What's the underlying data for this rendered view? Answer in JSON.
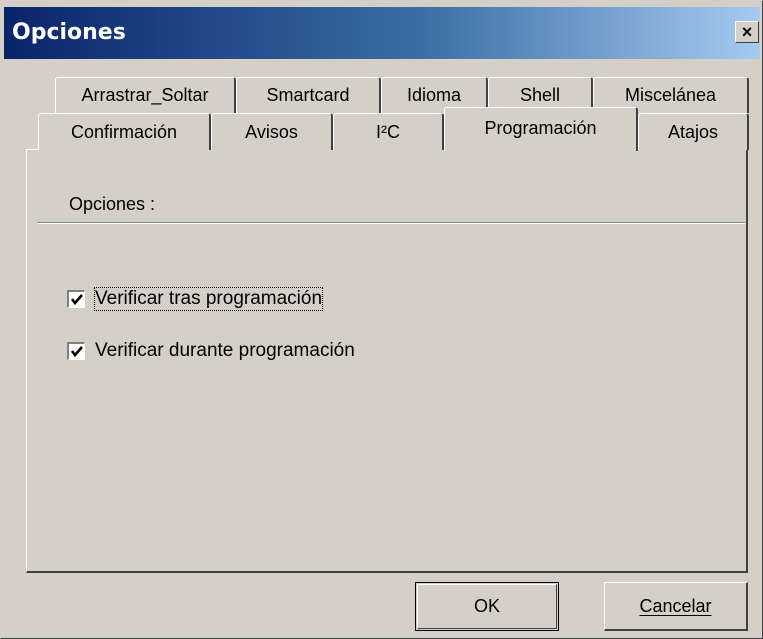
{
  "window": {
    "title": "Opciones",
    "close_label": "×"
  },
  "tabs_row1": [
    {
      "label": "Arrastrar_Soltar"
    },
    {
      "label": "Smartcard"
    },
    {
      "label": "Idioma"
    },
    {
      "label": "Shell"
    },
    {
      "label": "Miscelánea"
    }
  ],
  "tabs_row2": [
    {
      "label": "Confirmación"
    },
    {
      "label": "Avisos"
    },
    {
      "label": "I²C"
    },
    {
      "label": "Programación",
      "active": true
    },
    {
      "label": "Atajos"
    }
  ],
  "panel": {
    "group_label": "Opciones :",
    "checkboxes": [
      {
        "label": "Verificar tras programación",
        "checked": true
      },
      {
        "label": "Verificar durante programación",
        "checked": true
      }
    ]
  },
  "buttons": {
    "ok": "OK",
    "cancel": "Cancelar"
  },
  "colors": {
    "face": "#d4d0c8",
    "title_start": "#0a246a",
    "title_end": "#a6caf0"
  }
}
